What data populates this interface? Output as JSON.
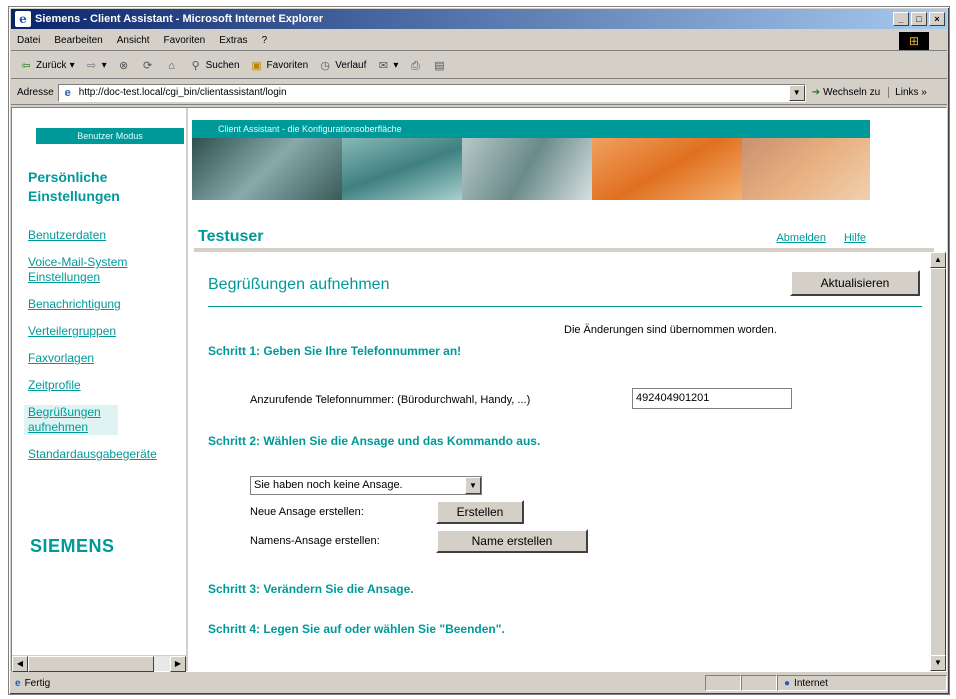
{
  "window": {
    "title": "Siemens - Client Assistant - Microsoft Internet Explorer",
    "controls": [
      "_",
      "□",
      "×"
    ]
  },
  "menubar": [
    "Datei",
    "Bearbeiten",
    "Ansicht",
    "Favoriten",
    "Extras",
    "?"
  ],
  "toolbar": {
    "back": "Zurück",
    "search": "Suchen",
    "favorites": "Favoriten",
    "history": "Verlauf"
  },
  "addressbar": {
    "label": "Adresse",
    "url": "http://doc-test.local/cgi_bin/clientassistant/login",
    "go": "Wechseln zu",
    "links": "Links »"
  },
  "left": {
    "mode": "Benutzer Modus",
    "title_line1": "Persönliche",
    "title_line2": "Einstellungen",
    "items": [
      {
        "label": "Benutzerdaten"
      },
      {
        "label": "Voice-Mail-System Einstellungen"
      },
      {
        "label": "Benachrichtigung"
      },
      {
        "label": "Verteilergruppen"
      },
      {
        "label": "Faxvorlagen"
      },
      {
        "label": "Zeitprofile"
      },
      {
        "label": "Begrüßungen aufnehmen"
      },
      {
        "label": "Standardausgabegeräte"
      }
    ],
    "logo": "SIEMENS"
  },
  "banner": {
    "caption": "Client Assistant - die Konfigurationsoberfläche"
  },
  "header": {
    "username": "Testuser",
    "logout": "Abmelden",
    "help": "Hilfe"
  },
  "main": {
    "title": "Begrüßungen aufnehmen",
    "refresh": "Aktualisieren",
    "status": "Die Änderungen sind übernommen worden.",
    "step1": "Schritt 1: Geben Sie Ihre Telefonnummer an!",
    "phone_label": "Anzurufende Telefonnummer: (Bürodurchwahl, Handy, ...)",
    "phone_value": "492404901201",
    "step2": "Schritt 2: Wählen Sie die Ansage und das Kommando aus.",
    "select_value": "Sie haben noch keine Ansage.",
    "new_label": "Neue Ansage erstellen:",
    "new_button": "Erstellen",
    "name_label": "Namens-Ansage erstellen:",
    "name_button": "Name erstellen",
    "step3": "Schritt 3: Verändern Sie die Ansage.",
    "step4": "Schritt 4: Legen Sie auf oder wählen Sie \"Beenden\"."
  },
  "status": {
    "text": "Fertig",
    "zone": "Internet"
  }
}
